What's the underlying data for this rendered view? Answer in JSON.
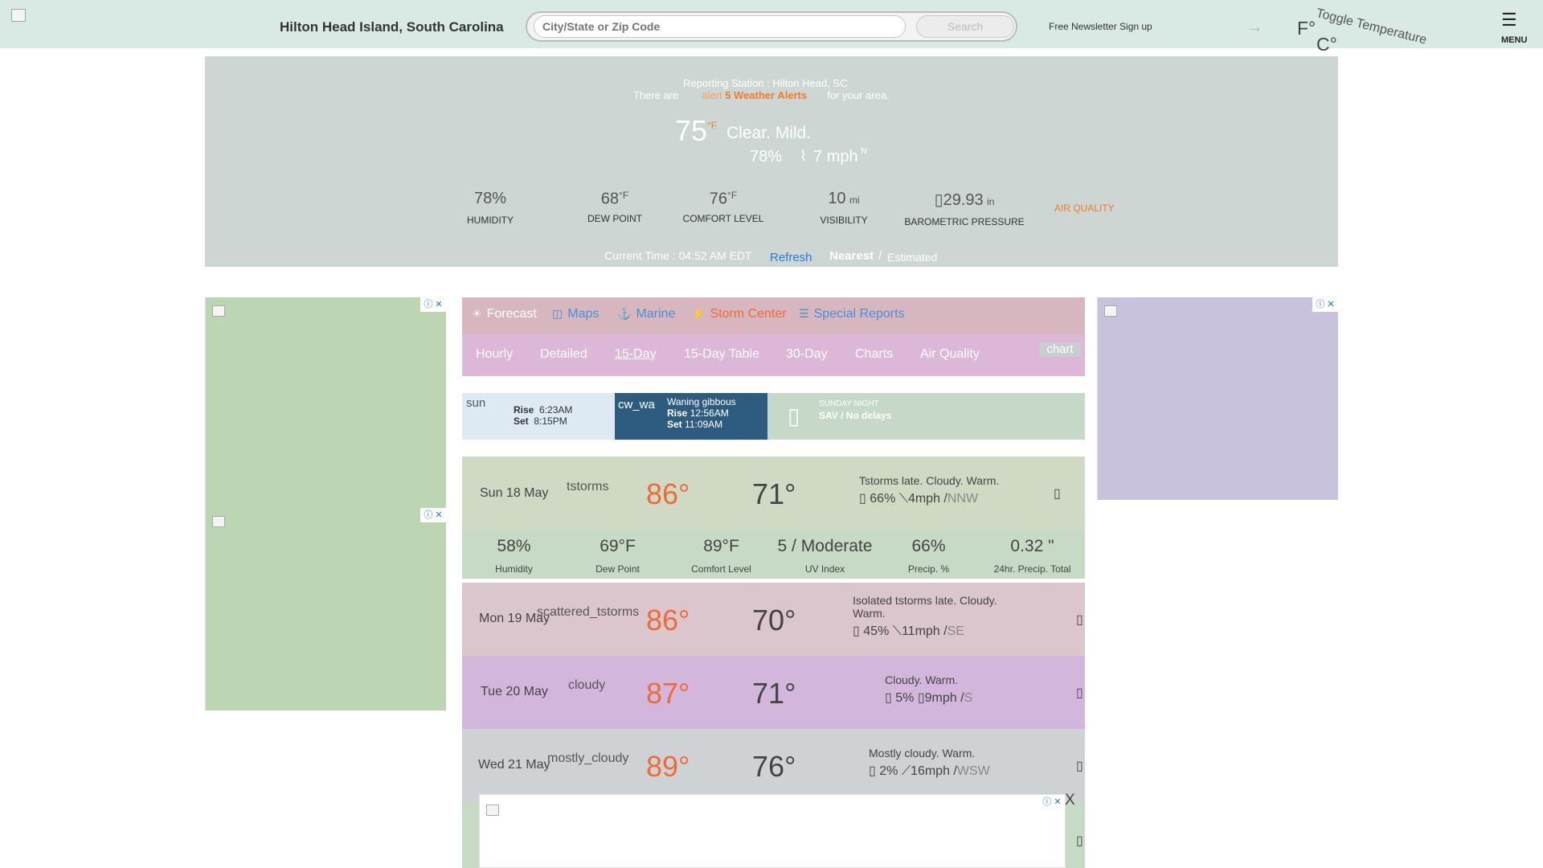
{
  "header": {
    "location": "Hilton Head Island, South Carolina",
    "search_placeholder": "City/State or Zip Code",
    "search_button": "Search",
    "newsletter": "Free Newsletter Sign up",
    "unit_f": "F°",
    "unit_c": "C°",
    "toggle_alt": "Toggle Temperature",
    "menu_label": "MENU"
  },
  "current": {
    "station": "Reporting Station : Hilton Head, SC",
    "alerts_prefix": "There are",
    "alerts_icon_alt": "alert",
    "alerts_link": "5 Weather Alerts",
    "alerts_suffix": "for your area.",
    "temp": "75",
    "temp_unit": "°F",
    "condition": "Clear. Mild.",
    "humidity_small": "78%",
    "wind_small": "7 mph",
    "wind_dir": "N",
    "stats": [
      {
        "value": "78%",
        "sup": "",
        "label": "HUMIDITY"
      },
      {
        "value": "68",
        "sup": "°F",
        "label": "DEW POINT"
      },
      {
        "value": "76",
        "sup": "°F",
        "label": "COMFORT LEVEL"
      },
      {
        "value": "10",
        "sup": "mi",
        "label": "VISIBILITY"
      },
      {
        "value": "29.93",
        "sup": "in",
        "label": "BAROMETRIC PRESSURE"
      }
    ],
    "air_quality": "AIR QUALITY",
    "current_time": "Current Time : 04:52 AM EDT",
    "refresh_alt": "Refresh",
    "nearest": "Nearest",
    "slash": "/",
    "estimated": "Estimated"
  },
  "nav": {
    "tabs": [
      {
        "label": "Forecast",
        "icon": "forecast-icon"
      },
      {
        "label": "Maps",
        "icon": "maps-icon"
      },
      {
        "label": "Marine",
        "icon": "marine-icon"
      },
      {
        "label": "Storm Center",
        "icon": "storm-icon"
      },
      {
        "label": "Special Reports",
        "icon": "special-reports-icon"
      }
    ],
    "sub": [
      "Hourly",
      "Detailed",
      "15-Day",
      "15-Day Table",
      "30-Day",
      "Charts",
      "Air Quality"
    ],
    "chart_alt": "chart"
  },
  "astro": {
    "sun_alt": "sun",
    "sun_rise_label": "Rise",
    "sun_rise": "6:23AM",
    "sun_set_label": "Set",
    "sun_set": "8:15PM",
    "moon_alt": "cw_wa",
    "moon_phase": "Waning gibbous",
    "moon_rise_label": "Rise",
    "moon_rise": "12:56AM",
    "moon_set_label": "Set",
    "moon_set": "11:09AM",
    "note_label": "SUNDAY NIGHT",
    "note_value": "SAV / No delays"
  },
  "forecast": [
    {
      "date": "Sun 18 May",
      "icon_alt": "tstorms",
      "hi": "86°",
      "lo": "71°",
      "desc": "Tstorms late. Cloudy. Warm.",
      "precip": "66%",
      "wind": "4mph",
      "dir": "NNW"
    },
    {
      "date": "Mon 19 May",
      "icon_alt": "scattered_tstorms",
      "hi": "86°",
      "lo": "70°",
      "desc": "Isolated tstorms late. Cloudy. Warm.",
      "precip": "45%",
      "wind": "11mph",
      "dir": "SE"
    },
    {
      "date": "Tue 20 May",
      "icon_alt": "cloudy",
      "hi": "87°",
      "lo": "71°",
      "desc": "Cloudy. Warm.",
      "precip": "5%",
      "wind": "9mph",
      "dir": "S"
    },
    {
      "date": "Wed 21 May",
      "icon_alt": "mostly_cloudy",
      "hi": "89°",
      "lo": "76°",
      "desc": "Mostly cloudy. Warm.",
      "precip": "2%",
      "wind": "16mph",
      "dir": "WSW"
    }
  ],
  "details": [
    {
      "value": "58%",
      "label": "Humidity"
    },
    {
      "value": "69°F",
      "label": "Dew Point"
    },
    {
      "value": "89°F",
      "label": "Comfort Level"
    },
    {
      "value": "5 / Moderate",
      "label": "UV Index"
    },
    {
      "value": "66%",
      "label": "Precip. %"
    },
    {
      "value": "0.32 \"",
      "label": "24hr. Precip. Total"
    }
  ],
  "ads": {
    "close": "ⓘ ✕",
    "bottom_close": "X"
  },
  "colors": {
    "header_bg": "#d9eae4",
    "panel_bg": "#cdd6d3",
    "accent_orange": "#f07b2b",
    "nav_bg": "#d7b6bf",
    "subnav_bg": "#dcb7d8",
    "detail_bg": "#c6dac5"
  }
}
